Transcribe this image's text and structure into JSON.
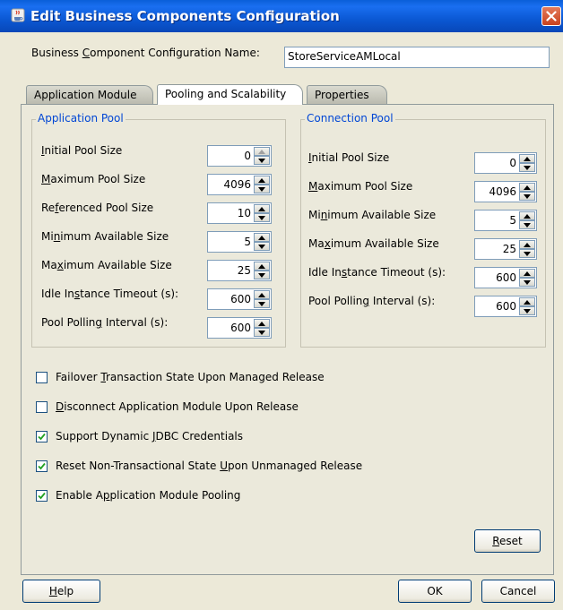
{
  "window": {
    "title": "Edit Business Components Configuration",
    "icon": "java-cup-icon",
    "close_icon": "close-icon"
  },
  "config_name": {
    "label_pre": "Business ",
    "label_mnemonic": "C",
    "label_post": "omponent Configuration Name:",
    "value": "StoreServiceAMLocal"
  },
  "tabs": [
    {
      "label": "Application Module",
      "active": false
    },
    {
      "label": "Pooling and Scalability",
      "active": true
    },
    {
      "label": "Properties",
      "active": false
    }
  ],
  "app_pool": {
    "title": "Application Pool",
    "fields": [
      {
        "pre": "",
        "mn": "I",
        "post": "nitial Pool Size",
        "value": "0",
        "up_disabled": true
      },
      {
        "pre": "",
        "mn": "M",
        "post": "aximum Pool Size",
        "value": "4096",
        "up_disabled": false
      },
      {
        "pre": "Re",
        "mn": "f",
        "post": "erenced Pool Size",
        "value": "10",
        "up_disabled": false
      },
      {
        "pre": "Mi",
        "mn": "n",
        "post": "imum Available Size",
        "value": "5",
        "up_disabled": false
      },
      {
        "pre": "Ma",
        "mn": "x",
        "post": "imum Available Size",
        "value": "25",
        "up_disabled": false
      },
      {
        "pre": "Idle In",
        "mn": "s",
        "post": "tance Timeout (s):",
        "value": "600",
        "up_disabled": false
      },
      {
        "pre": "Pool Pollin",
        "mn": "g",
        "post": " Interval (s):",
        "value": "600",
        "up_disabled": false
      }
    ]
  },
  "conn_pool": {
    "title": "Connection Pool",
    "fields": [
      {
        "pre": "",
        "mn": "I",
        "post": "nitial Pool Size",
        "value": "0",
        "up_disabled": false
      },
      {
        "pre": "",
        "mn": "M",
        "post": "aximum Pool Size",
        "value": "4096",
        "up_disabled": false
      },
      {
        "pre": "Mi",
        "mn": "n",
        "post": "imum Available Size",
        "value": "5",
        "up_disabled": false
      },
      {
        "pre": "Ma",
        "mn": "x",
        "post": "imum Available Size",
        "value": "25",
        "up_disabled": false
      },
      {
        "pre": "Idle In",
        "mn": "s",
        "post": "tance Timeout (s):",
        "value": "600",
        "up_disabled": false
      },
      {
        "pre": "Pool Pollin",
        "mn": "g",
        "post": " Interval (s):",
        "value": "600",
        "up_disabled": false
      }
    ]
  },
  "options": [
    {
      "pre": "Failover ",
      "mn": "T",
      "post": "ransaction State Upon Managed Release",
      "checked": false
    },
    {
      "pre": "",
      "mn": "D",
      "post": "isconnect Application Module Upon Release",
      "checked": false
    },
    {
      "pre": "Support Dynamic ",
      "mn": "J",
      "post": "DBC Credentials",
      "checked": true
    },
    {
      "pre": "Reset Non-Transactional State ",
      "mn": "U",
      "post": "pon Unmanaged Release",
      "checked": true
    },
    {
      "pre": "Enable A",
      "mn": "p",
      "post": "plication Module Pooling",
      "checked": true
    }
  ],
  "buttons": {
    "reset": {
      "pre": "",
      "mn": "R",
      "post": "eset"
    },
    "help": {
      "pre": "",
      "mn": "H",
      "post": "elp"
    },
    "ok": "OK",
    "cancel": "Cancel"
  },
  "colors": {
    "titlebar": "#0b58d4",
    "group_title": "#0046d5",
    "dialog_bg": "#ece9d8"
  }
}
